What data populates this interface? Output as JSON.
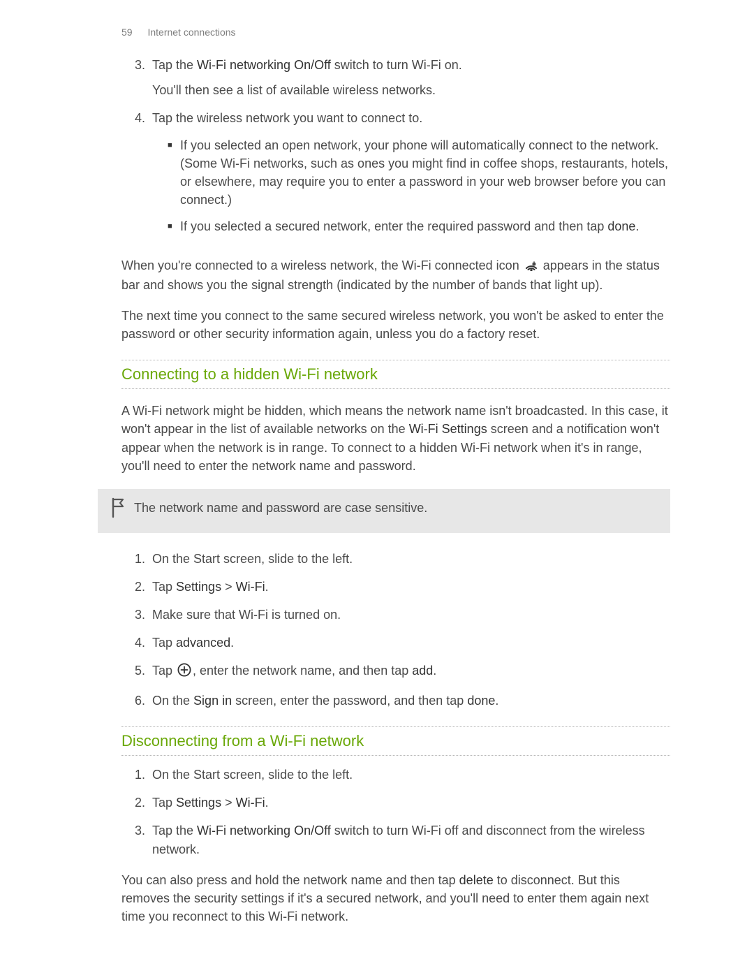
{
  "page_header": {
    "number": "59",
    "section": "Internet connections"
  },
  "intro_list": {
    "item3": {
      "marker": "3.",
      "prefix": "Tap the ",
      "bold": "Wi-Fi networking On/Off",
      "suffix": " switch to turn Wi-Fi on.",
      "follow": "You'll then see a list of available wireless networks."
    },
    "item4": {
      "marker": "4.",
      "text": "Tap the wireless network you want to connect to.",
      "b1": "If you selected an open network, your phone will automatically connect to the network. (Some Wi-Fi networks, such as ones you might find in coffee shops, restaurants, hotels, or elsewhere, may require you to enter a password in your web browser before you can connect.)",
      "b2a": "If you selected a secured network, enter the required password and then tap ",
      "b2bold": "done",
      "b2b": "."
    }
  },
  "post1a": "When you're connected to a wireless network, the Wi-Fi connected icon ",
  "post1b": " appears in the status bar and shows you the signal strength (indicated by the number of bands that light up).",
  "post2": "The next time you connect to the same secured wireless network, you won't be asked to enter the password or other security information again, unless you do a factory reset.",
  "sectionA": {
    "title": "Connecting to a hidden Wi-Fi network",
    "intro_a": "A Wi-Fi network might be hidden, which means the network name isn't broadcasted. In this case, it won't appear in the list of available networks on the ",
    "intro_bold": "Wi-Fi Settings",
    "intro_b": " screen and a notification won't appear when the network is in range. To connect to a hidden Wi-Fi network when it's in range, you'll need to enter the network name and password.",
    "callout": "The network name and password are case sensitive.",
    "steps": {
      "s1": {
        "marker": "1.",
        "text": "On the Start screen, slide to the left."
      },
      "s2": {
        "marker": "2.",
        "pre": "Tap ",
        "b1": "Settings",
        "mid": " > ",
        "b2": "Wi-Fi",
        "post": "."
      },
      "s3": {
        "marker": "3.",
        "text": "Make sure that Wi-Fi is turned on."
      },
      "s4": {
        "marker": "4.",
        "pre": "Tap ",
        "b1": "advanced",
        "post": "."
      },
      "s5": {
        "marker": "5.",
        "pre": "Tap ",
        "mid": ", enter the network name, and then tap ",
        "b2": "add",
        "post": "."
      },
      "s6": {
        "marker": "6.",
        "pre": "On the ",
        "b1": "Sign in",
        "mid": " screen, enter the password, and then tap ",
        "b2": "done",
        "post": "."
      }
    }
  },
  "sectionB": {
    "title": "Disconnecting from a Wi-Fi network",
    "steps": {
      "s1": {
        "marker": "1.",
        "text": "On the Start screen, slide to the left."
      },
      "s2": {
        "marker": "2.",
        "pre": "Tap ",
        "b1": "Settings",
        "mid": " > ",
        "b2": "Wi-Fi",
        "post": "."
      },
      "s3": {
        "marker": "3.",
        "pre": "Tap the ",
        "b1": "Wi-Fi networking On/Off",
        "post": " switch to turn Wi-Fi off and disconnect from the wireless network."
      }
    },
    "outro_a": "You can also press and hold the network name and then tap ",
    "outro_bold": "delete",
    "outro_b": " to disconnect. But this removes the security settings if it's a secured network, and you'll need to enter them again next time you reconnect to this Wi-Fi network."
  }
}
